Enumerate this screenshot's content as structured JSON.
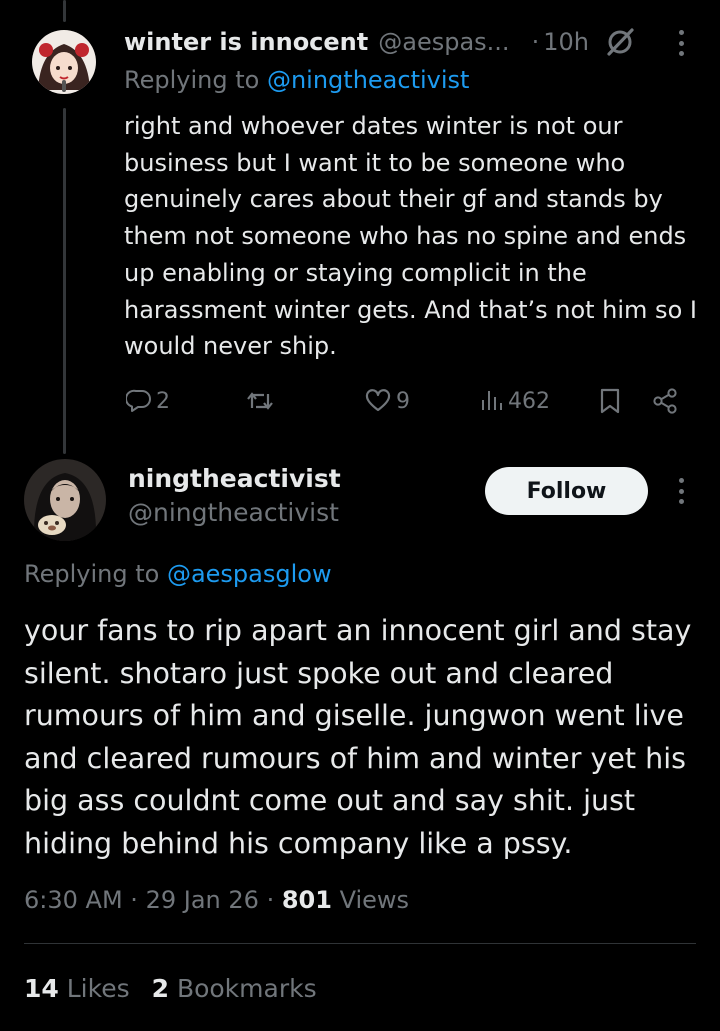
{
  "reply": {
    "display_name": "winter is innocent",
    "handle": "@aespas...",
    "separator": "·",
    "time": "10h",
    "replying_prefix": "Replying to",
    "replying_to": "@ningtheactivist",
    "text": "right and whoever dates winter is not our business but I want it to be someone who genuinely cares about their gf and stands by them not someone who has no spine and ends up enabling or staying complicit in the harassment winter gets. And that’s not him so I would never ship.",
    "actions": {
      "reply_count": "2",
      "repost_count": "",
      "like_count": "9",
      "view_count": "462"
    }
  },
  "tweet": {
    "display_name": "ningtheactivist",
    "handle": "@ningtheactivist",
    "follow_label": "Follow",
    "replying_prefix": "Replying to",
    "replying_to": "@aespasglow",
    "text": "your fans to rip apart an innocent girl and stay silent. shotaro just spoke out and cleared rumours of him and giselle. jungwon went live and cleared rumours of him and winter yet his big ass couldnt come out and say shit. just hiding behind his company like a pssy.",
    "time": "6:30 AM",
    "sep1": "·",
    "date": "29 Jan 26",
    "sep2": "·",
    "views_count": "801",
    "views_label": "Views",
    "likes_count": "14",
    "likes_label": "Likes",
    "bookmarks_count": "2",
    "bookmarks_label": "Bookmarks"
  },
  "icons": {
    "grok": "grok-icon",
    "more": "more-dots-icon",
    "reply": "speech-bubble-icon",
    "repost": "repost-arrows-icon",
    "like": "heart-icon",
    "views": "bar-chart-icon",
    "bookmark": "bookmark-icon",
    "share": "share-nodes-icon"
  },
  "colors": {
    "background": "#000000",
    "text_primary": "#e7e9ea",
    "text_secondary": "#71767b",
    "accent": "#1d9bf0",
    "follow_bg": "#eff3f4",
    "divider": "#2f3336"
  }
}
